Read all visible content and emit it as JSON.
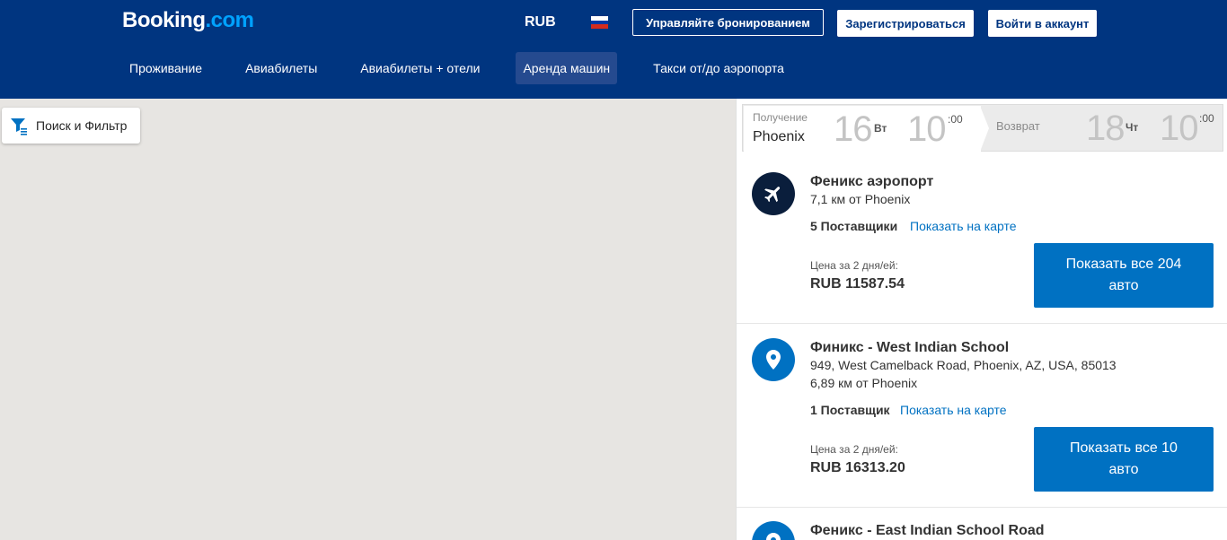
{
  "header": {
    "logo_main": "Booking",
    "logo_dot": ".com",
    "currency": "RUB",
    "manage_label": "Управляйте бронированием",
    "register_label": "Зарегистрироваться",
    "login_label": "Войти в аккаунт"
  },
  "nav": [
    {
      "label": "Проживание"
    },
    {
      "label": "Авиабилеты"
    },
    {
      "label": "Авиабилеты + отели"
    },
    {
      "label": "Аренда машин",
      "active": true
    },
    {
      "label": "Такси от/до аэропорта"
    }
  ],
  "map": {
    "filter_label": "Поиск и Фильтр"
  },
  "search": {
    "pickup_label": "Получение",
    "pickup_city": "Phoenix",
    "pickup_day": "16",
    "pickup_dow": "Вт",
    "pickup_hour": "10",
    "pickup_min": ":00",
    "return_label": "Возврат",
    "return_day": "18",
    "return_dow": "Чт",
    "return_hour": "10",
    "return_min": ":00"
  },
  "results": [
    {
      "icon": "airplane-icon",
      "title": "Феникс аэропорт",
      "distance": "7,1 км от Phoenix",
      "suppliers": "5 Поставщики",
      "map_link": "Показать на карте",
      "price_label": "Цена за 2 дня/ей:",
      "price": "RUB 11587.54",
      "button": "Показать все 204 авто"
    },
    {
      "icon": "location-pin-icon",
      "title": "Финикс - West Indian School",
      "address": "949, West Camelback Road, Phoenix, AZ, USA, 85013",
      "distance": "6,89 км от Phoenix",
      "suppliers": "1 Поставщик",
      "map_link": "Показать на карте",
      "price_label": "Цена за 2 дня/ей:",
      "price": "RUB 16313.20",
      "button": "Показать все 10 авто"
    },
    {
      "icon": "location-pin-icon",
      "title": "Феникс - East Indian School Road"
    }
  ],
  "colors": {
    "header_bg": "#003580",
    "accent_blue": "#0071c2",
    "map_bg": "#e7e5e2"
  }
}
